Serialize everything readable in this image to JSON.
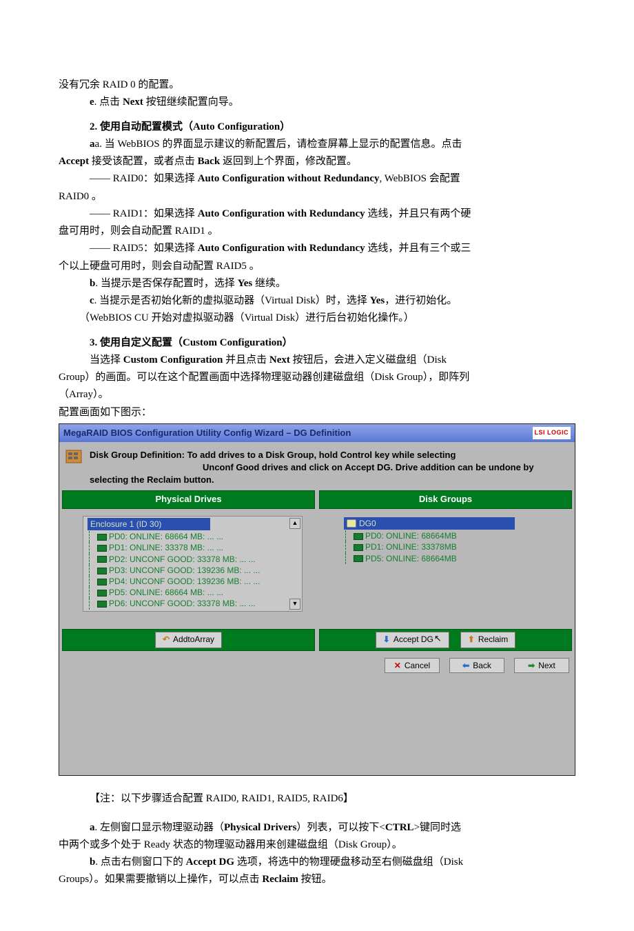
{
  "doc": {
    "p0": "没有冗余 RAID 0 的配置。",
    "p_e": "e. 点击 Next 按钮继续配置向导。",
    "h2": "2. 使用自动配置模式（Auto Configuration）",
    "p_a": "a. 当 WebBIOS 的界面显示建议的新配置后，请检查屏幕上显示的配置信息。点击",
    "p_a2": "Accept 接受该配置，或者点击 Back 返回到上个界面，修改配置。",
    "raid0_lbl": "—— RAID0：",
    "raid0_t1": "如果选择 ",
    "raid0_b": "Auto Configuration without Redundancy",
    "raid0_t2": ", WebBIOS 会配置",
    "raid0_l2": "RAID0 。",
    "raid1_lbl": "—— RAID1：",
    "raid1_t1": "如果选择 ",
    "raid1_b": "Auto Configuration with Redundancy",
    "raid1_t2": " 选线，并且只有两个硬",
    "raid1_l2": "盘可用时，则会自动配置 RAID1 。",
    "raid5_lbl": "—— RAID5：",
    "raid5_t1": "如果选择 ",
    "raid5_b": "Auto Configuration with Redundancy",
    "raid5_t2": " 选线，并且有三个或三",
    "raid5_l2": "个以上硬盘可用时，则会自动配置 RAID5 。",
    "p_b": "b. 当提示是否保存配置时，选择 Yes 继续。",
    "p_c": "c. 当提示是否初始化新的虚拟驱动器（Virtual Disk）时，选择 Yes，进行初始化。",
    "p_cu": "（WebBIOS CU 开始对虚拟驱动器（Virtual Disk）进行后台初始化操作。）",
    "h3": "3. 使用自定义配置（Custom Configuration）",
    "p3a": "当选择 Custom Configuration 并且点击 Next 按钮后，会进入定义磁盘组（Disk",
    "p3b": "Group）的画面。可以在这个配置画面中选择物理驱动器创建磁盘组（Disk Group），即阵列",
    "p3c": "（Array）。",
    "p3d": "配置画面如下图示：",
    "note": "【注：以下步骤适合配置 RAID0, RAID1, RAID5, RAID6】",
    "pa1": "a. 左侧窗口显示物理驱动器（Physical Drivers）列表，可以按下<CTRL>键同时选",
    "pa2": "中两个或多个处于 Ready 状态的物理驱动器用来创建磁盘组（Disk Group）。",
    "pb1": "b. 点击右侧窗口下的 Accept DG 选项，将选中的物理硬盘移动至右侧磁盘组（Disk",
    "pb2": "Groups）。如果需要撤销以上操作，可以点击 Reclaim 按钮。"
  },
  "panel": {
    "title": "MegaRAID BIOS Configuration Utility Config Wizard – DG Definition",
    "lsi": "LSI LOGIC",
    "def_b": "Disk Group Definition:",
    "def_t1": " To add drives to a Disk Group, hold Control key while selecting",
    "def_t2": "Unconf Good drives and click on Accept DG. Drive addition can be undone by selecting the Reclaim button.",
    "col_phys": "Physical Drives",
    "col_dg": "Disk Groups",
    "phys_root": "Enclosure 1 (ID 30)",
    "phys": [
      "PD0: ONLINE: 68664 MB: ... ...",
      "PD1: ONLINE: 33378 MB: ... ...",
      "PD2: UNCONF GOOD: 33378 MB: ... ...",
      "PD3: UNCONF GOOD: 139236 MB: ... ...",
      "PD4: UNCONF GOOD: 139236 MB: ... ...",
      "PD5: ONLINE: 68664 MB: ... ...",
      "PD6: UNCONF GOOD: 33378 MB: ... ..."
    ],
    "dg_root": "DG0",
    "dgs": [
      "PD0: ONLINE: 68664MB",
      "PD1: ONLINE: 33378MB",
      "PD5: ONLINE: 68664MB"
    ],
    "btn_add": "AddtoArray",
    "btn_accept": "Accept DG",
    "btn_reclaim": "Reclaim",
    "btn_cancel": "Cancel",
    "btn_back": "Back",
    "btn_next": "Next"
  }
}
